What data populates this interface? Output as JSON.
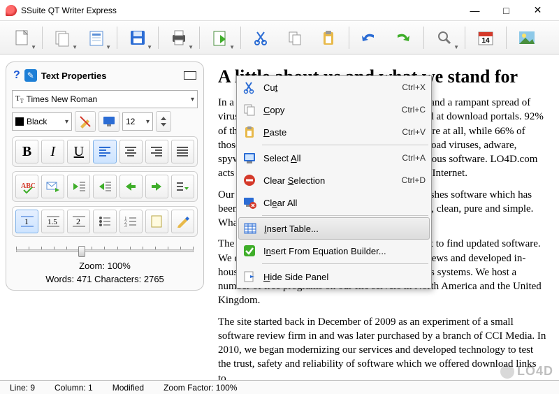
{
  "app": {
    "title": "SSuite QT Writer Express"
  },
  "sidebar": {
    "header": {
      "title": "Text Properties"
    },
    "font": "Times New Roman",
    "color": "Black",
    "size": "12",
    "zoom": "Zoom: 100%",
    "stats": "Words: 471  Characters: 2765"
  },
  "document": {
    "heading": "A little about us and what we stand for",
    "p1": "In a world of endless scamware, adware, malware and a rampant spread of virus-and trojan-bundled applications being offered at download portals. 92% of the top 25 download portals don't test for malware at all, while 66% of those that do test attempt to push the user to download viruses, adware, spyware applications and other unwanted or malicious software. LO4D.com acts as an oasis in a desert of a very much infected Internet.",
    "p2": "Our download portal is one of the few which publishes software which has been tested and verified as safe. We're mean, green, clean, pure and simple. What you see is what you get.",
    "p3": "The portal was born from the idea that it is difficult to find updated software. We do not accept any money from vendors for reviews and developed in-house to identify threats to the security of Windows systems. We host a number of free programs on our file servers in North America and the United Kingdom.",
    "p4": "The site started back in December of 2009 as an experiment of a small software review firm in and was later purchased by a branch of CCI Media. In 2010, we began modernizing our services and developed technology to test the trust, safety and reliability of software which we offered download links to."
  },
  "context": {
    "cut": "Cut",
    "cut_sc": "Ctrl+X",
    "copy": "Copy",
    "copy_sc": "Ctrl+C",
    "paste": "Paste",
    "paste_sc": "Ctrl+V",
    "selall": "Select All",
    "selall_sc": "Ctrl+A",
    "clearsel": "Clear Selection",
    "clearsel_sc": "Ctrl+D",
    "clearall": "Clear All",
    "instable": "Insert Table...",
    "inseq": "Insert From Equation Builder...",
    "hide": "Hide Side Panel"
  },
  "status": {
    "line": "Line:  9",
    "col": "Column:  1",
    "mod": "Modified",
    "zoom": "Zoom Factor: 100%"
  },
  "watermark": "LO4D"
}
